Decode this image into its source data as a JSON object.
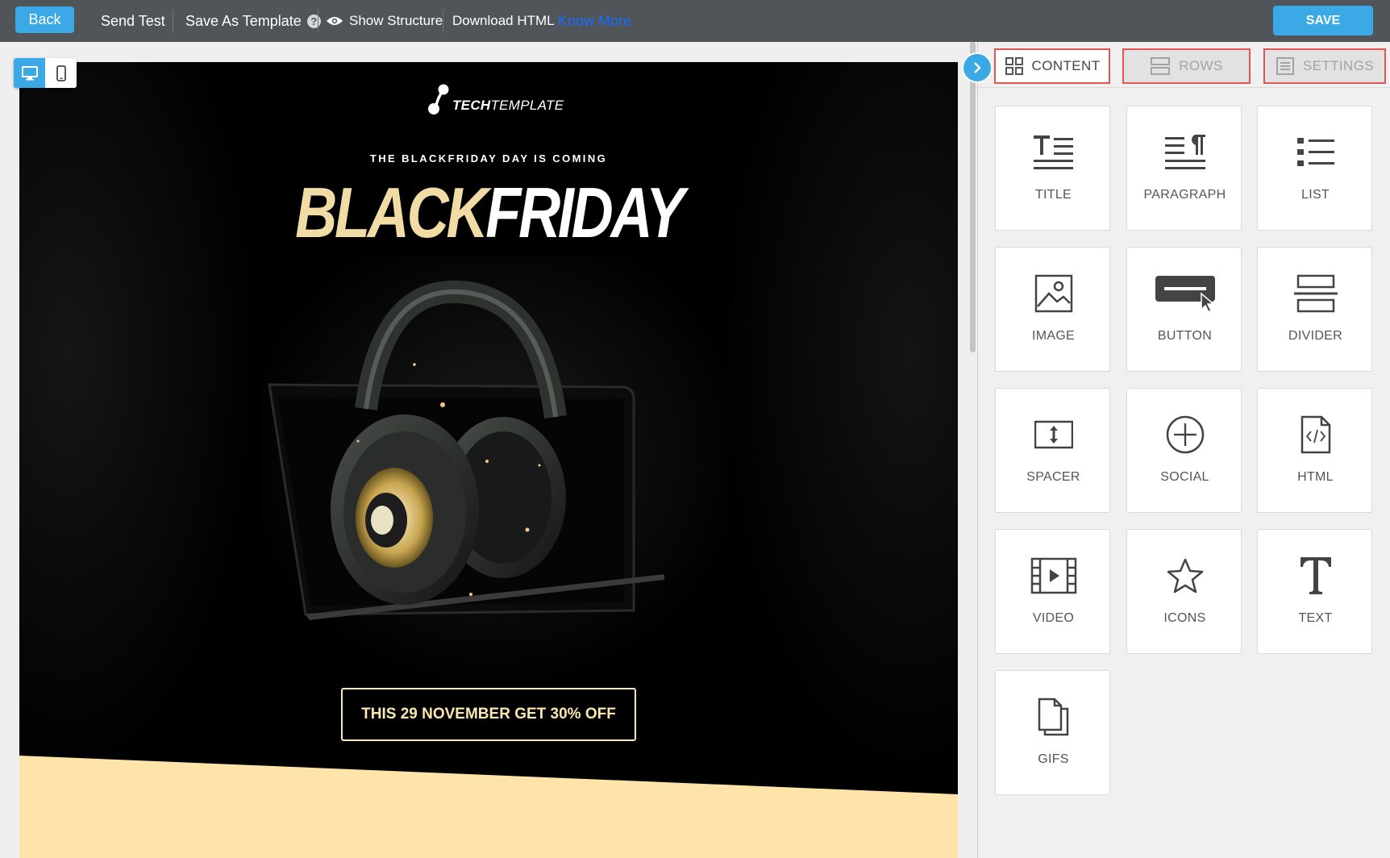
{
  "toolbar": {
    "back_label": "Back",
    "send_test_label": "Send Test",
    "save_template_label": "Save As Template",
    "help_symbol": "?",
    "show_structure_label": "Show Structure",
    "download_html_label": "Download HTML",
    "know_more_label": "Know More",
    "save_label": "SAVE"
  },
  "email": {
    "logo_bold": "TECH",
    "logo_light": "TEMPLATE",
    "subtitle": "THE BLACKFRIDAY DAY IS COMING",
    "headline_part1": "BLACK",
    "headline_part2": "FRIDAY",
    "cta_label": "THIS 29 NOVEMBER GET 30% OFF"
  },
  "panel": {
    "tabs": {
      "content": "CONTENT",
      "rows": "ROWS",
      "settings": "SETTINGS"
    },
    "blocks": [
      {
        "label": "TITLE",
        "icon": "title-icon"
      },
      {
        "label": "PARAGRAPH",
        "icon": "paragraph-icon"
      },
      {
        "label": "LIST",
        "icon": "list-icon"
      },
      {
        "label": "IMAGE",
        "icon": "image-icon"
      },
      {
        "label": "BUTTON",
        "icon": "button-icon"
      },
      {
        "label": "DIVIDER",
        "icon": "divider-icon"
      },
      {
        "label": "SPACER",
        "icon": "spacer-icon"
      },
      {
        "label": "SOCIAL",
        "icon": "social-icon"
      },
      {
        "label": "HTML",
        "icon": "html-icon"
      },
      {
        "label": "VIDEO",
        "icon": "video-icon"
      },
      {
        "label": "ICONS",
        "icon": "icons-icon"
      },
      {
        "label": "TEXT",
        "icon": "text-icon"
      },
      {
        "label": "GIFS",
        "icon": "gifs-icon"
      }
    ]
  },
  "colors": {
    "accent": "#3aa9e6",
    "toolbar_bg": "#505559",
    "tab_highlight": "#e45454",
    "email_gold": "#f2dca6",
    "email_cream": "#ffe4aa"
  }
}
